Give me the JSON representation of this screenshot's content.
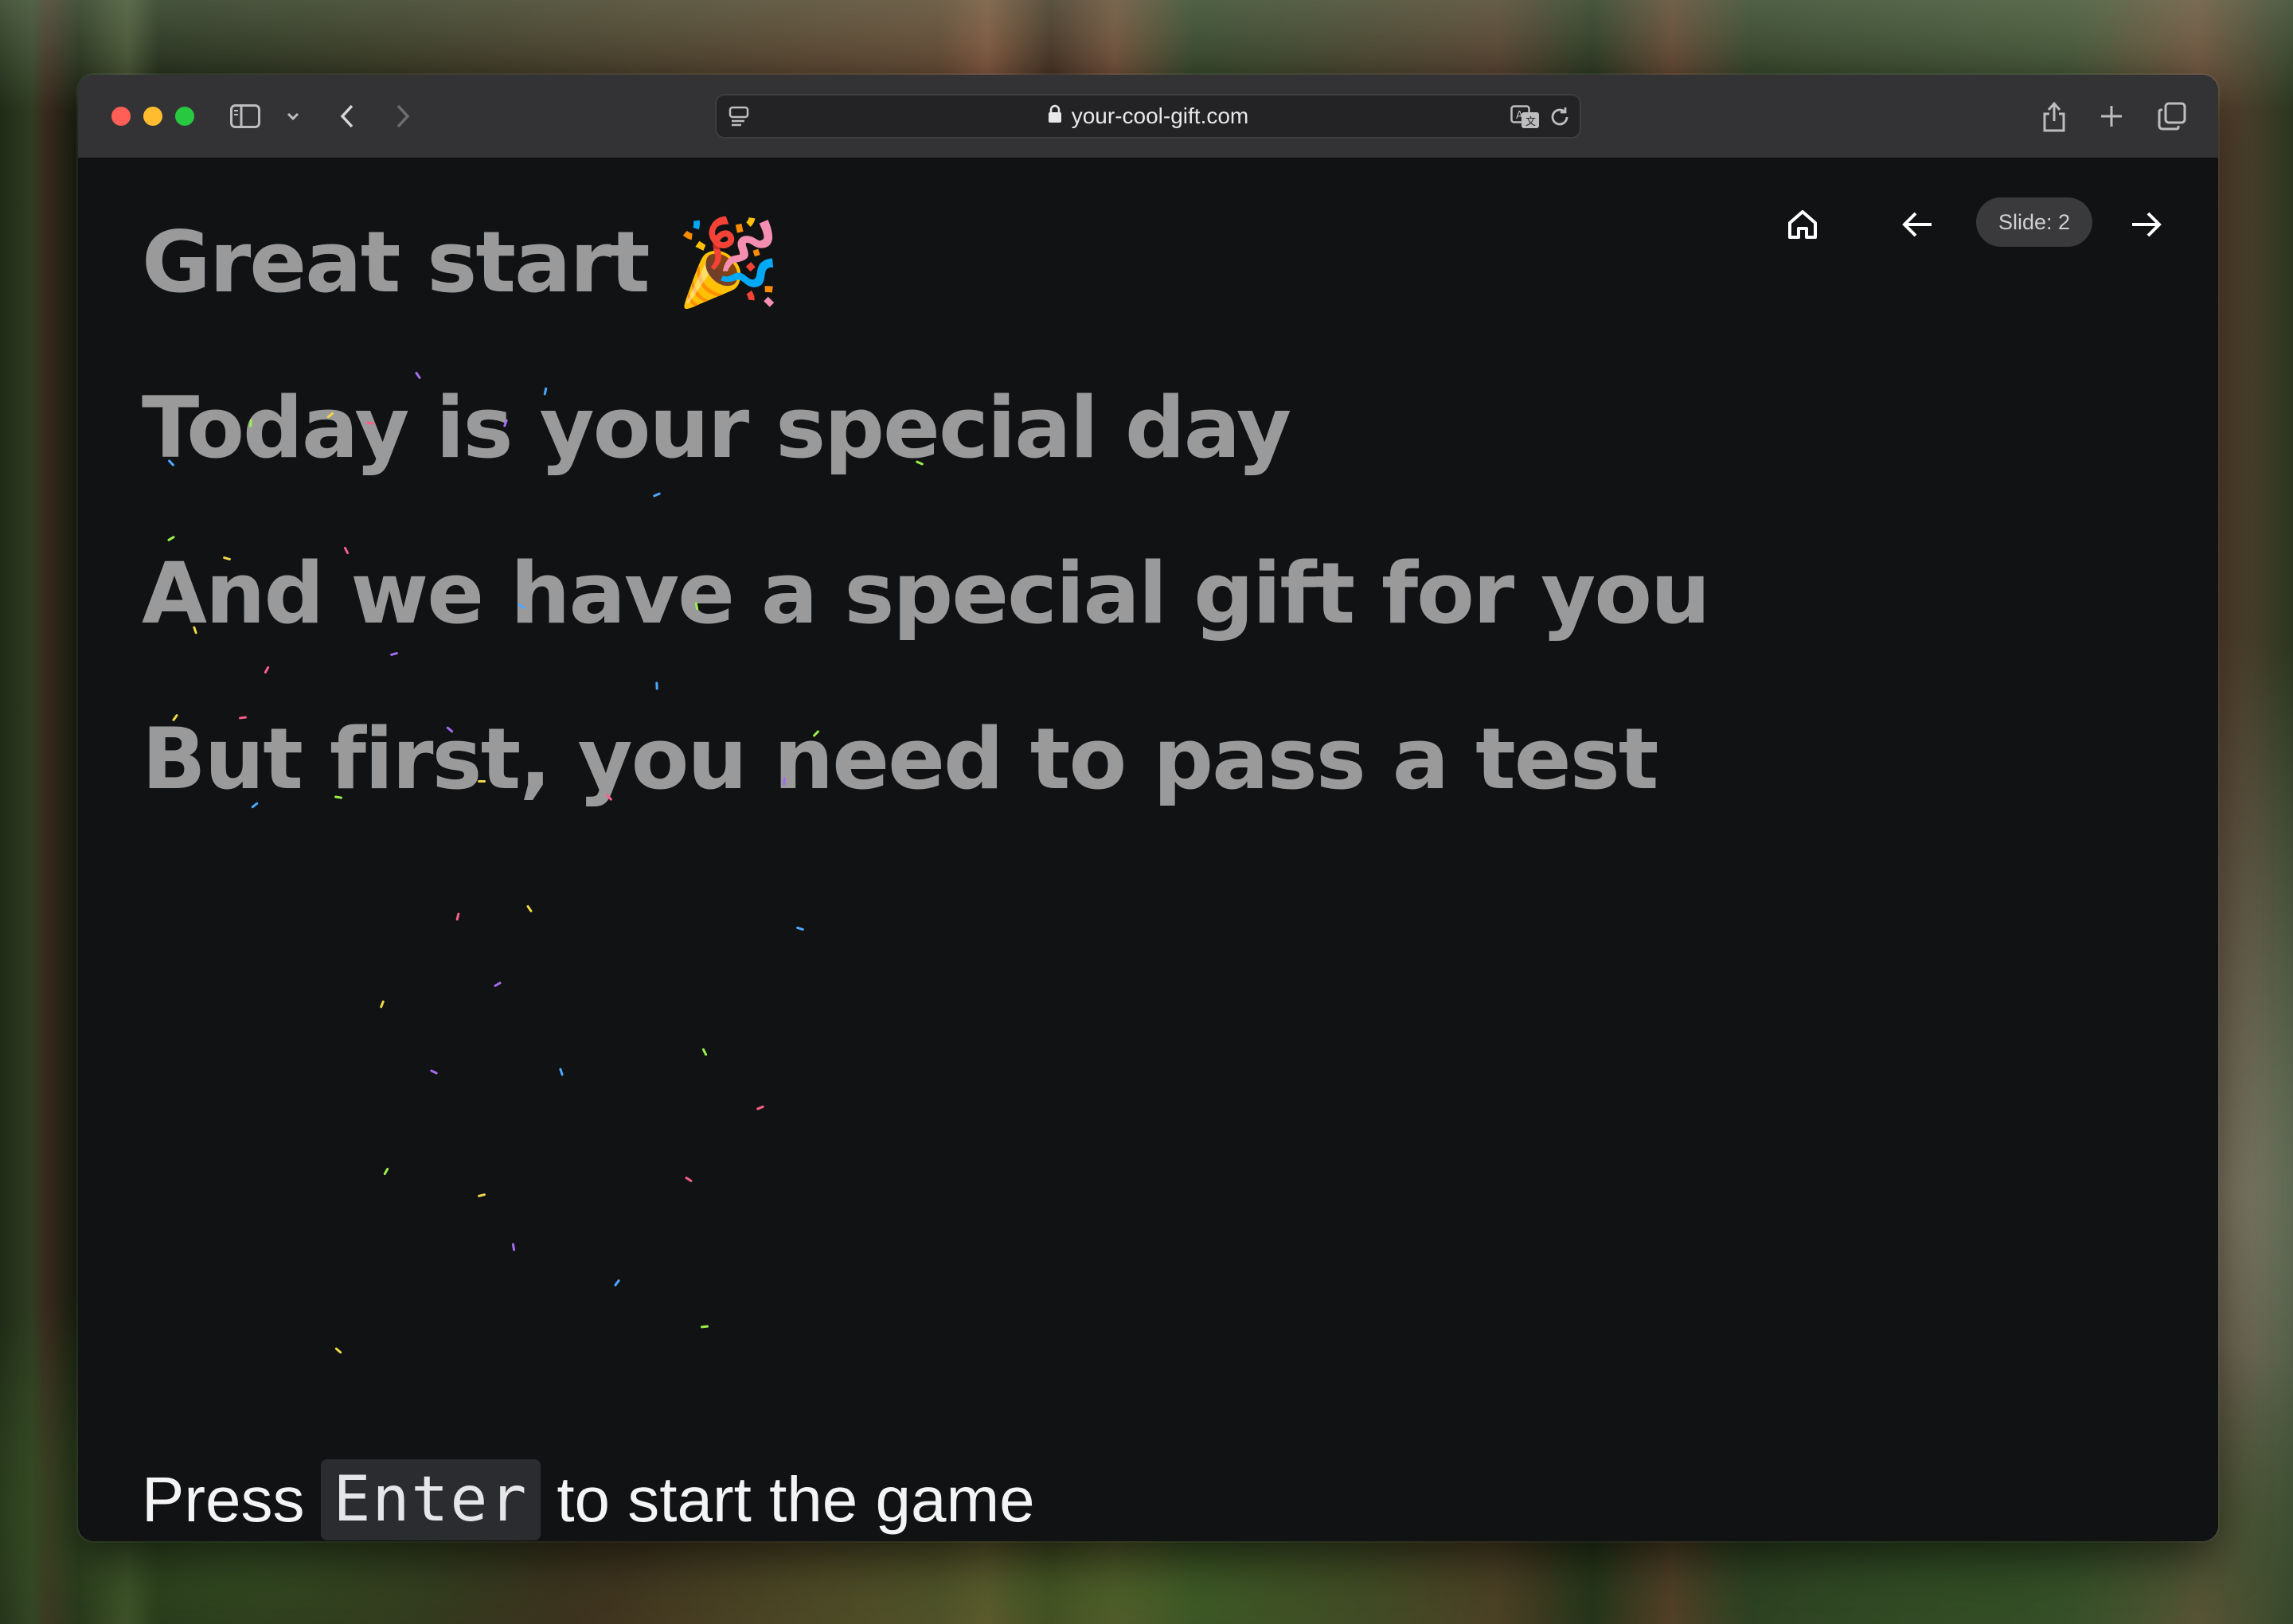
{
  "browser": {
    "url": "your-cool-gift.com"
  },
  "slide": {
    "lines": [
      "Great start 🎉",
      "Today is your special day",
      "And we have a special gift for you",
      "But first, you need to pass a test"
    ],
    "indicator": "Slide: 2"
  },
  "footer": {
    "press": "Press",
    "key": "Enter",
    "rest": "to start the game"
  },
  "icons": {
    "toolbar": [
      "sidebar-icon",
      "chevron-down-icon",
      "back-icon",
      "forward-icon",
      "reader-icon",
      "lock-icon",
      "translate-icon",
      "reload-icon",
      "share-icon",
      "plus-icon",
      "tabs-icon"
    ],
    "slide_nav": [
      "home-icon",
      "arrow-left-icon",
      "arrow-right-icon"
    ]
  },
  "colors": {
    "background": "#111214",
    "headline": "#9a9a9b",
    "toolbar": "#333335",
    "confetti": [
      "#a56bf0",
      "#4aa8ff",
      "#9cf04a",
      "#f0d84a",
      "#ff5f8a"
    ]
  }
}
